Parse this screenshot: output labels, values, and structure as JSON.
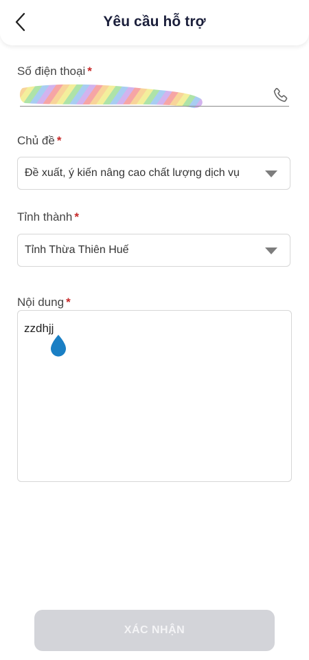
{
  "header": {
    "title": "Yêu cầu hỗ trợ",
    "back_icon": "chevron-left-icon"
  },
  "form": {
    "phone": {
      "label": "Số điện thoại",
      "required_mark": "*",
      "value": "",
      "icon": "phone-icon"
    },
    "topic": {
      "label": "Chủ đề",
      "required_mark": "*",
      "selected": "Đề xuất, ý kiến nâng cao chất lượng dịch vụ"
    },
    "province": {
      "label": "Tỉnh thành",
      "required_mark": "*",
      "selected": "Tỉnh Thừa Thiên Huế"
    },
    "content": {
      "label": "Nội dung",
      "required_mark": "*",
      "value": "zzdhjj"
    }
  },
  "submit": {
    "label": "XÁC NHẬN",
    "disabled": true
  },
  "colors": {
    "title": "#1b1f3b",
    "required": "#c62828",
    "button_disabled": "#d3d4d9",
    "cursor_handle": "#1a7fc4"
  }
}
